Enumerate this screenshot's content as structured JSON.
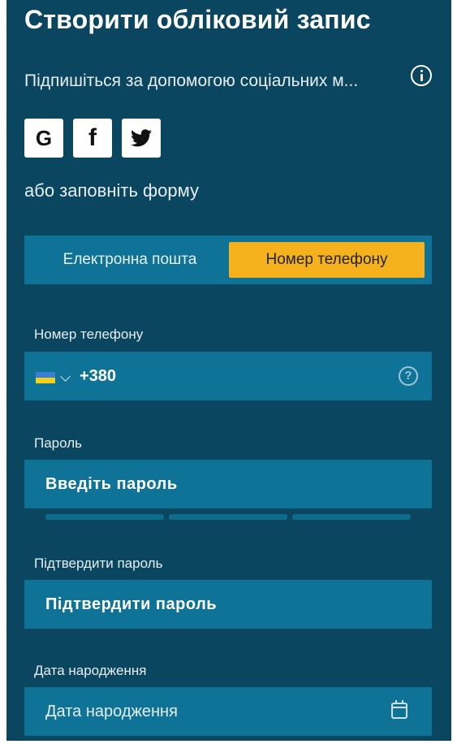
{
  "header": {
    "title": "Створити обліковий запис",
    "subtitle": "Підпишіться за допомогою соціальних м..."
  },
  "social": {
    "google_label": "G",
    "facebook_label": "f",
    "twitter_label": ""
  },
  "or_text": "або заповніть форму",
  "tabs": [
    {
      "label": "Електронна пошта",
      "active": false
    },
    {
      "label": "Номер телефону",
      "active": true
    }
  ],
  "phone": {
    "label": "Номер телефону",
    "prefix": "+380",
    "help_glyph": "?"
  },
  "password": {
    "label": "Пароль",
    "placeholder": "Введіть пароль"
  },
  "confirm_password": {
    "label": "Підтвердити пароль",
    "placeholder": "Підтвердити пароль"
  },
  "birthdate": {
    "label": "Дата народження",
    "placeholder": "Дата народження"
  },
  "colors": {
    "background": "#0b4660",
    "field": "#0f7397",
    "accent": "#f5b21c"
  },
  "icons": [
    "info-icon",
    "google-icon",
    "facebook-icon",
    "twitter-icon",
    "ukraine-flag-icon",
    "chevron-down-icon",
    "help-icon",
    "calendar-icon"
  ]
}
